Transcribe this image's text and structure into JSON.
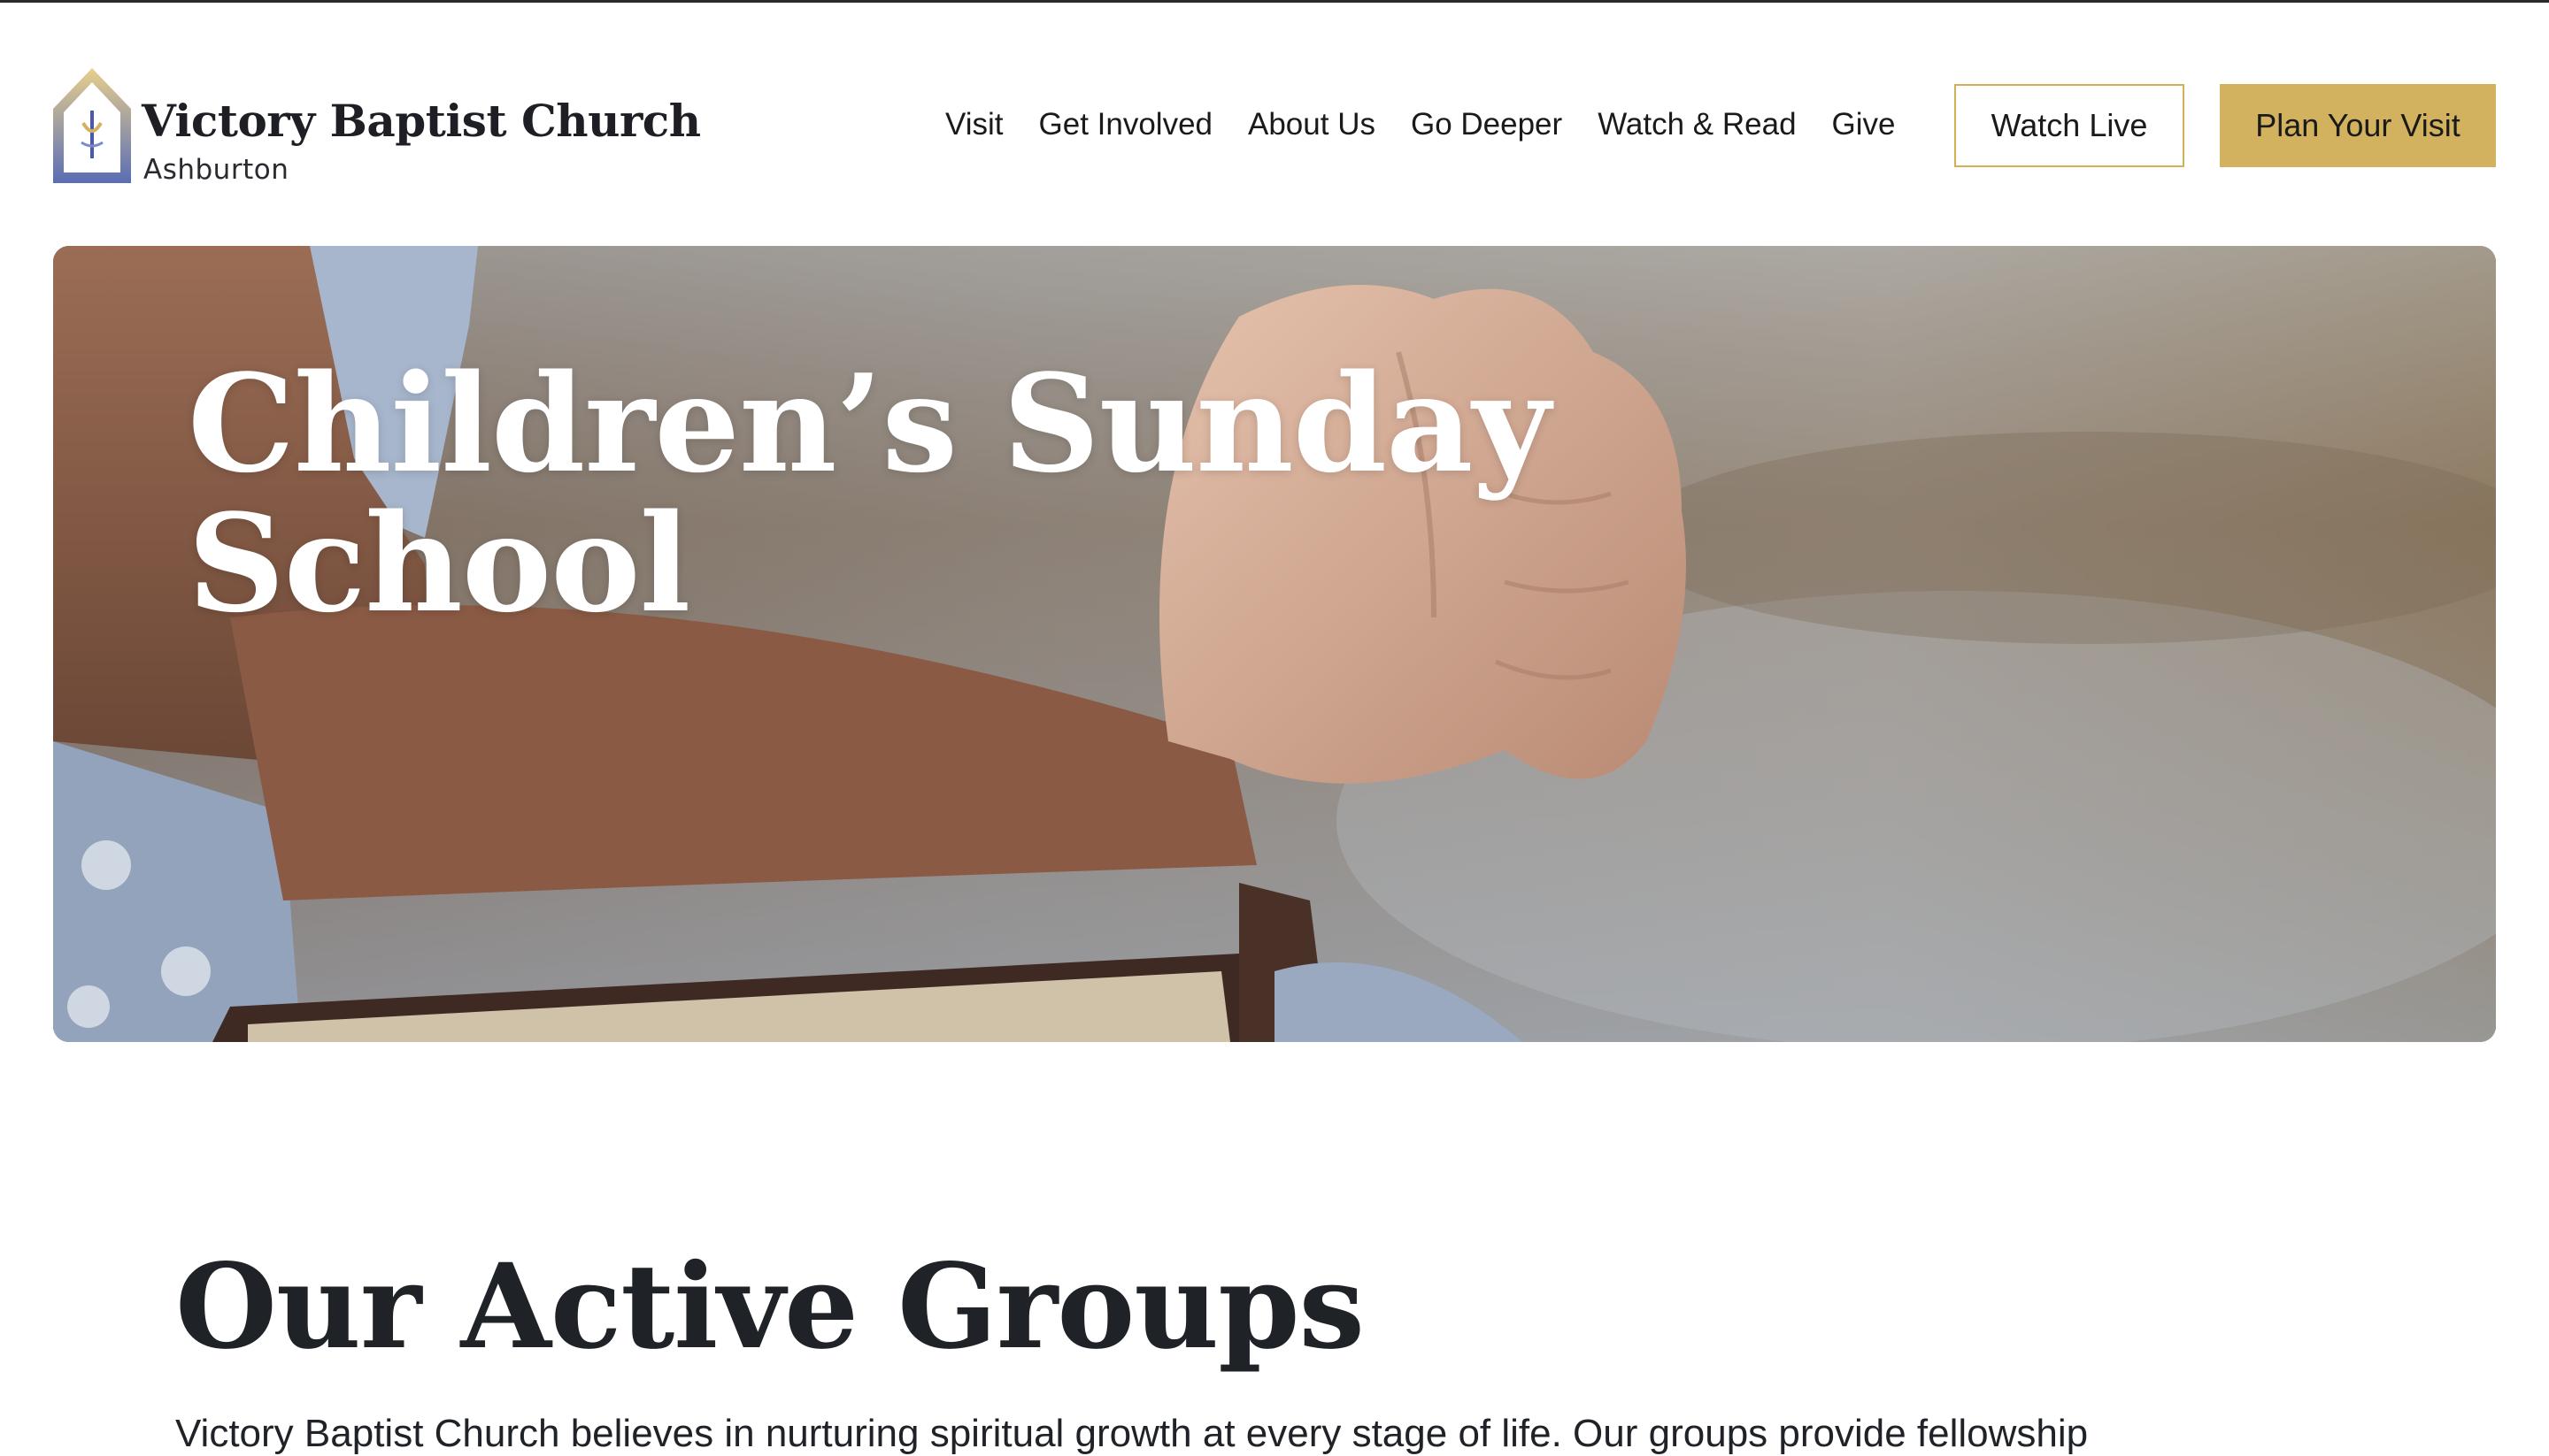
{
  "brand": {
    "name": "Victory Baptist Church",
    "location": "Ashburton",
    "logo_icon": "church-logo-icon"
  },
  "nav": {
    "links": [
      "Visit",
      "Get Involved",
      "About Us",
      "Go Deeper",
      "Watch & Read",
      "Give"
    ],
    "watch_live": "Watch Live",
    "plan_visit": "Plan Your Visit"
  },
  "hero": {
    "title_line1": "Children’s Sunday",
    "title_line2": "School",
    "image": "child-praying-hands-on-bible-photo"
  },
  "groups": {
    "title": "Our Active Groups",
    "intro": "Victory Baptist Church believes in nurturing spiritual growth at every stage of life. Our groups provide fellowship"
  },
  "colors": {
    "accent_gold": "#d3b25f",
    "text_dark": "#1f2227",
    "logo_blue": "#5c6fb3"
  }
}
